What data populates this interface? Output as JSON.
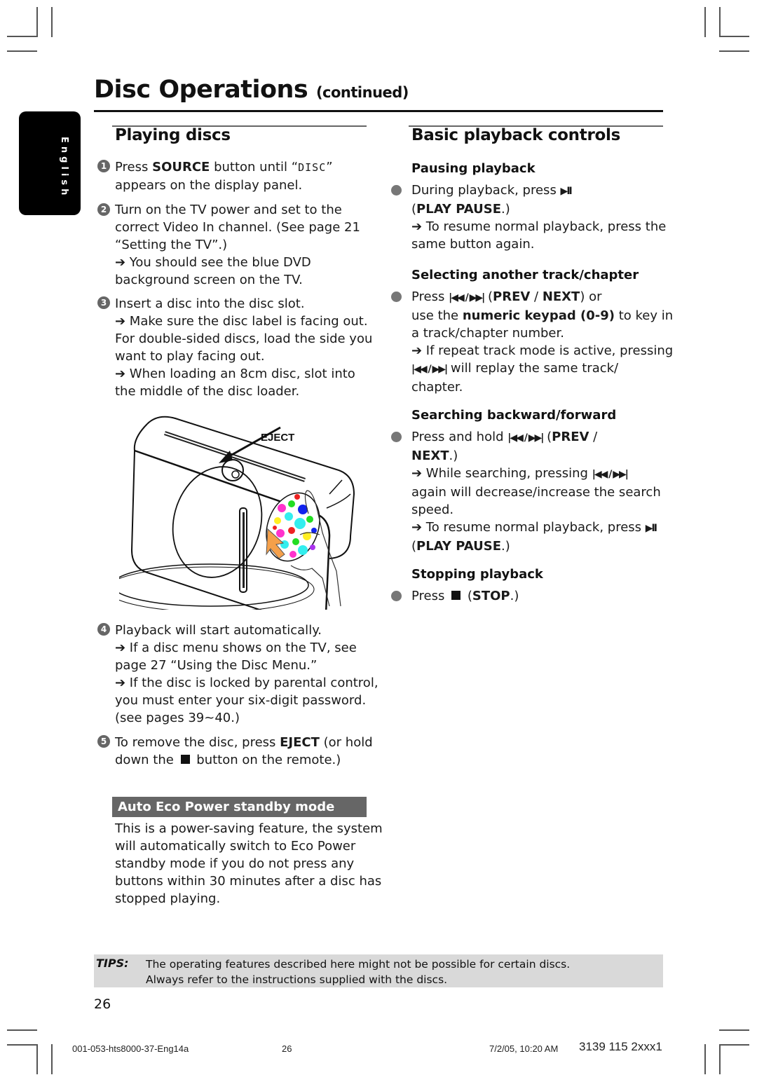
{
  "header": {
    "title": "Disc Operations",
    "title_suffix": "(continued)",
    "language_tab": "English"
  },
  "left": {
    "heading": "Playing discs",
    "steps": [
      {
        "number": "1",
        "lines": [
          "Press ",
          "SOURCE",
          " button until “",
          "DISC",
          "”",
          "appears on the display panel."
        ]
      },
      {
        "number": "2",
        "lines": [
          "Turn on the TV power and set to the",
          "correct Video In channel.  (See page 21",
          "“Setting the TV”.)",
          "➔ You should see the blue DVD",
          "background screen on the TV."
        ]
      },
      {
        "number": "3",
        "lines": [
          "Insert a disc into the disc slot.",
          "➔ Make sure the disc label is facing out.",
          "For double-sided discs, load the side you",
          "want to play facing out.",
          "➔ When loading an 8cm disc, slot into",
          "the middle of the disc loader."
        ]
      },
      {
        "number": "4",
        "lines": [
          "Playback will start automatically.",
          "➔ If a disc menu shows on the TV, see",
          "page 27 “Using the Disc Menu.”",
          "➔ If the disc is locked by parental control,",
          "you must enter your six-digit password.",
          "(see pages 39~40.)"
        ]
      },
      {
        "number": "5",
        "lines": [
          "To remove the disc, press ",
          "EJECT",
          " (or hold",
          "down the ",
          " button on the remote.)"
        ]
      }
    ],
    "figure": {
      "eject_label": "EJECT",
      "arrow_color": "#f5a04a"
    },
    "eco": {
      "heading": "Auto Eco Power standby mode",
      "lines": [
        "This is a power-saving feature, the system",
        "will automatically switch to Eco Power",
        "standby mode if you do not press any",
        "buttons within 30 minutes after a disc has",
        "stopped playing."
      ]
    }
  },
  "right": {
    "heading": "Basic playback controls",
    "sections": [
      {
        "title": "Pausing playback",
        "lines": [
          "During playback, press ",
          "▶II",
          "(",
          "PLAY PAUSE",
          ".)",
          "➔ To resume normal playback, press the",
          "same button again."
        ]
      },
      {
        "title": "Selecting another track/chapter",
        "lines": [
          "Press ",
          "|◀◀ / ▶▶|",
          " (",
          "PREV",
          " / ",
          "NEXT",
          ") or",
          "use the ",
          "numeric keypad (0-9)",
          " to key in",
          "a track/chapter number.",
          "➔ If repeat track mode is active, pressing",
          "|◀◀ / ▶▶|",
          " will replay the same track/",
          "chapter."
        ]
      },
      {
        "title": "Searching backward/forward",
        "lines": [
          "Press and hold ",
          "|◀◀ / ▶▶|",
          " (",
          "PREV",
          " /",
          "NEXT",
          ".)",
          "➔ While searching, pressing ",
          "|◀◀ / ▶▶|",
          "again will decrease/increase the search",
          "speed.",
          "➔ To resume normal playback, press ",
          "▶II",
          "(",
          "PLAY PAUSE",
          ".)"
        ]
      },
      {
        "title": "Stopping playback",
        "lines": [
          "Press ",
          " (",
          "STOP",
          ".)"
        ]
      }
    ]
  },
  "tips": {
    "label": "TIPS:",
    "lines": [
      "The operating features described here might not be possible for certain discs.",
      "Always refer to the instructions supplied with the discs."
    ]
  },
  "page_number": "26",
  "footer": {
    "file": "001-053-hts8000-37-Eng14a",
    "page": "26",
    "date": "7/2/05, 10:20 AM",
    "code": "3139 115 2xxx1"
  }
}
